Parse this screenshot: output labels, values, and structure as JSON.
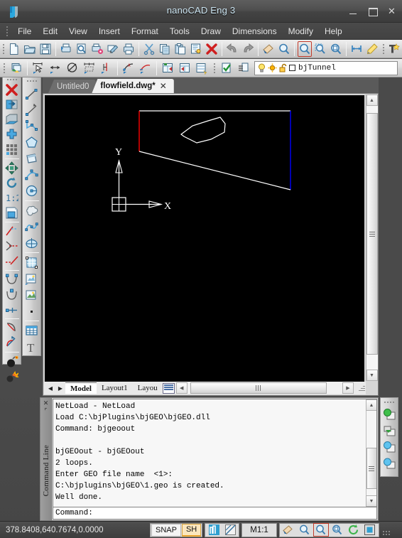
{
  "window": {
    "title": "nanoCAD Eng 3",
    "logo_icon": "nanocad-logo-icon",
    "minimize_label": "–",
    "maximize_label": "☐",
    "close_label": "✕"
  },
  "menu": {
    "items": [
      {
        "label": "File"
      },
      {
        "label": "Edit"
      },
      {
        "label": "View"
      },
      {
        "label": "Insert"
      },
      {
        "label": "Format"
      },
      {
        "label": "Tools"
      },
      {
        "label": "Draw"
      },
      {
        "label": "Dimensions"
      },
      {
        "label": "Modify"
      },
      {
        "label": "Help"
      }
    ]
  },
  "toolbar_standard": {
    "buttons": [
      {
        "icon": "new-file-icon",
        "label": "New"
      },
      {
        "icon": "open-folder-icon",
        "label": "Open"
      },
      {
        "icon": "save-floppy-icon",
        "label": "Save"
      },
      {
        "icon": "print-plot-icon",
        "label": "Plot"
      },
      {
        "icon": "print-preview-icon",
        "label": "Print Preview"
      },
      {
        "icon": "plot-settings-icon",
        "label": "Plot Settings"
      },
      {
        "icon": "publish-icon",
        "label": "Publish"
      },
      {
        "icon": "printer-icon",
        "label": "Print"
      },
      {
        "icon": "cut-scissors-icon",
        "label": "Cut"
      },
      {
        "icon": "copy-icon",
        "label": "Copy"
      },
      {
        "icon": "paste-icon",
        "label": "Paste"
      },
      {
        "icon": "match-properties-icon",
        "label": "Match Properties"
      },
      {
        "icon": "erase-red-x-icon",
        "label": "Erase"
      },
      {
        "icon": "undo-arrow-icon",
        "label": "Undo"
      },
      {
        "icon": "redo-arrow-icon",
        "label": "Redo"
      },
      {
        "icon": "pan-hand-icon",
        "label": "Pan"
      },
      {
        "icon": "zoom-realtime-icon",
        "label": "Zoom Realtime"
      },
      {
        "icon": "zoom-window-icon",
        "label": "Zoom Window"
      },
      {
        "icon": "zoom-previous-icon",
        "label": "Zoom Previous"
      },
      {
        "icon": "zoom-extents-icon",
        "label": "Zoom Extents"
      },
      {
        "icon": "distance-measure-icon",
        "label": "Distance"
      },
      {
        "icon": "highlight-marker-icon",
        "label": "Marker"
      },
      {
        "icon": "text-style-icon",
        "label": "Text Style"
      }
    ]
  },
  "toolbar_layers": {
    "buttons": [
      {
        "icon": "layers-stack-icon",
        "label": "Layers"
      },
      {
        "icon": "dimension-linear-icon",
        "label": "Linear Dimension"
      },
      {
        "icon": "dimension-aligned-icon",
        "label": "Aligned Dimension"
      },
      {
        "icon": "dimension-diameter-icon",
        "label": "Diameter Dimension"
      },
      {
        "icon": "dimension-baseline-icon",
        "label": "Baseline Dimension"
      },
      {
        "icon": "dimension-center-icon",
        "label": "Center Mark"
      },
      {
        "icon": "tolerance-add-icon",
        "label": "Add Tolerance"
      },
      {
        "icon": "tolerance-remove-icon",
        "label": "Remove Tolerance"
      },
      {
        "icon": "table-export-icon",
        "label": "Export Table"
      },
      {
        "icon": "table-import-icon",
        "label": "Import Table"
      },
      {
        "icon": "table-style-icon",
        "label": "Table Style"
      },
      {
        "icon": "layer-check-icon",
        "label": "Layer States"
      },
      {
        "icon": "layer-previous-icon",
        "label": "Previous Layer"
      }
    ],
    "layer": {
      "lightbulb_icon": "lightbulb-on-icon",
      "freeze_icon": "sun-thaw-icon",
      "lock_icon": "unlocked-padlock-icon",
      "color_swatch": "#ffffff",
      "name": "bjTunnel"
    }
  },
  "left_toolbar_draw": {
    "buttons": [
      {
        "icon": "erase-red-x-icon",
        "label": "Erase"
      },
      {
        "icon": "mirror-icon",
        "label": "Mirror"
      },
      {
        "icon": "chamfer-icon",
        "label": "Chamfer"
      },
      {
        "icon": "move-copy-icon",
        "label": "Copy"
      },
      {
        "icon": "array-grid-icon",
        "label": "Array"
      },
      {
        "icon": "move-arrows-icon",
        "label": "Move"
      },
      {
        "icon": "rotate-icon",
        "label": "Rotate"
      },
      {
        "icon": "scale-1-2-icon",
        "label": "Scale"
      },
      {
        "icon": "stretch-icon",
        "label": "Stretch"
      },
      {
        "icon": "trim-icon",
        "label": "Trim"
      },
      {
        "icon": "extend-icon",
        "label": "Extend"
      },
      {
        "icon": "break-icon",
        "label": "Break"
      },
      {
        "icon": "join-icon",
        "label": "Join"
      },
      {
        "icon": "explode-icon",
        "label": "Explode"
      },
      {
        "icon": "edit-polyline-icon",
        "label": "Edit Polyline"
      },
      {
        "icon": "fillet-icon",
        "label": "Fillet"
      },
      {
        "icon": "chamfer-2-icon",
        "label": "Chamfer 2"
      },
      {
        "icon": "bomb-icon",
        "label": "Purge"
      },
      {
        "icon": "explode-burst-icon",
        "label": "Explode All"
      }
    ]
  },
  "left_toolbar_modify": {
    "buttons": [
      {
        "icon": "line-icon",
        "label": "Line"
      },
      {
        "icon": "ray-icon",
        "label": "Ray"
      },
      {
        "icon": "polyline-icon",
        "label": "Polyline"
      },
      {
        "icon": "polygon-icon",
        "label": "Polygon"
      },
      {
        "icon": "rectangle-icon",
        "label": "Rectangle"
      },
      {
        "icon": "arc-icon",
        "label": "Arc"
      },
      {
        "icon": "circle-icon",
        "label": "Circle"
      },
      {
        "icon": "revision-cloud-icon",
        "label": "Revision Cloud"
      },
      {
        "icon": "spline-icon",
        "label": "Spline"
      },
      {
        "icon": "ellipse-icon",
        "label": "Ellipse"
      },
      {
        "icon": "hatch-icon",
        "label": "Hatch"
      },
      {
        "icon": "block-insert-icon",
        "label": "Insert Block"
      },
      {
        "icon": "make-block-icon",
        "label": "Make Block"
      },
      {
        "icon": "point-icon",
        "label": "Point"
      },
      {
        "icon": "table-icon",
        "label": "Table"
      },
      {
        "icon": "text-icon",
        "label": "Multiline Text"
      }
    ]
  },
  "document": {
    "tabs": [
      {
        "label": "Untitled0",
        "active": false,
        "closable": false
      },
      {
        "label": "flowfield.dwg*",
        "active": true,
        "closable": true,
        "close_label": "✕"
      }
    ],
    "layout_tabs": [
      {
        "label": "Model",
        "active": true
      },
      {
        "label": "Layout1",
        "active": false
      },
      {
        "label": "Layou",
        "active": false
      }
    ],
    "nav_first": "◀",
    "nav_last": "▶",
    "scroll_up": "▲",
    "scroll_down": "▼",
    "hscroll_left": "◀",
    "hscroll_right": "▶"
  },
  "drawing": {
    "background": "#000000",
    "ucs": {
      "x_label": "X",
      "y_label": "Y",
      "origin_icon": "ucs-origin-icon"
    },
    "entities": [
      {
        "name": "boundary-top-edge",
        "color": "#ffffff"
      },
      {
        "name": "boundary-left-edge",
        "color": "#ff0000"
      },
      {
        "name": "boundary-right-edge",
        "color": "#0000ff"
      },
      {
        "name": "boundary-bottom-edge",
        "color": "#ffffff"
      },
      {
        "name": "inner-polygon",
        "color": "#ffffff"
      }
    ]
  },
  "command_line": {
    "panel_title": "Command Line",
    "close_icon": "✕",
    "pin_icon": "⇔",
    "history": [
      "NetLoad - NetLoad",
      "Load C:\\bjPlugins\\bjGEO\\bjGEO.dll",
      "Command: bjgeoout",
      "",
      "bjGEOout - bjGEOout",
      "2 loops.",
      "Enter GEO file name  <1>:",
      "C:\\bjplugins\\bjGEO\\1.geo is created.",
      "Well done."
    ],
    "prompt": "Command:",
    "input_value": "",
    "side_buttons": [
      {
        "icon": "window-green-icon",
        "label": "New Window"
      },
      {
        "icon": "window-arrow-green-icon",
        "label": "Restore Window"
      },
      {
        "icon": "window-blue-icon",
        "label": "Blue Window"
      },
      {
        "icon": "window-blue-2-icon",
        "label": "Second Blue Window"
      }
    ]
  },
  "status_bar": {
    "coordinates": "378.8408,640.7674,0.0000",
    "toggles": [
      {
        "label": "SNAP",
        "on": false
      },
      {
        "label": "SH",
        "on": true
      }
    ],
    "buttons": [
      {
        "icon": "model-space-icon",
        "label": "Model Space"
      },
      {
        "icon": "paper-space-icon",
        "label": "Paper Space"
      }
    ],
    "scale": "M1:1",
    "right_buttons": [
      {
        "icon": "pan-hand-icon",
        "label": "Pan",
        "active": false
      },
      {
        "icon": "zoom-realtime-icon",
        "label": "Zoom Realtime",
        "active": false
      },
      {
        "icon": "zoom-window-icon",
        "label": "Zoom Window",
        "active": true
      },
      {
        "icon": "zoom-previous-icon",
        "label": "Zoom Previous",
        "active": false
      },
      {
        "icon": "refresh-icon",
        "label": "Regen",
        "active": false
      },
      {
        "icon": "fullscreen-icon",
        "label": "Clean Screen",
        "active": false
      }
    ],
    "grip_icon": "resize-grip-icon"
  }
}
